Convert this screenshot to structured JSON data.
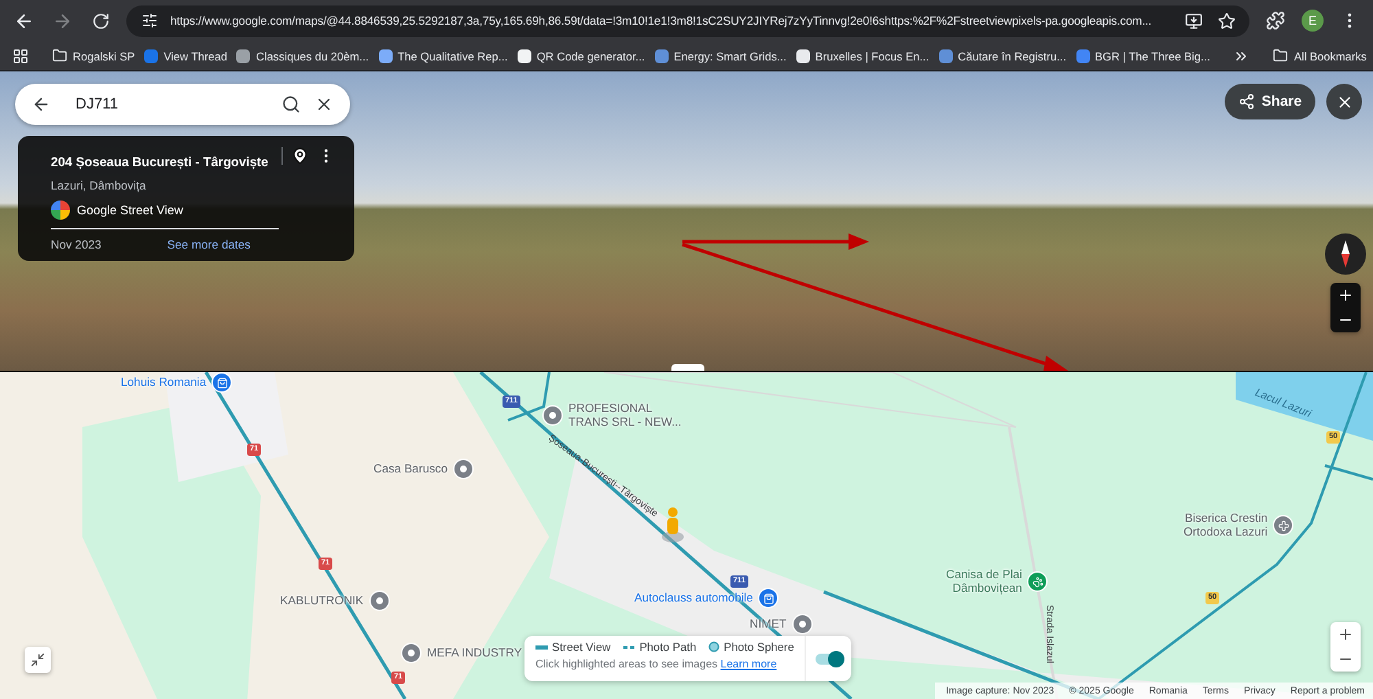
{
  "browser": {
    "url": "https://www.google.com/maps/@44.8846539,25.5292187,3a,75y,165.69h,86.59t/data=!3m10!1e1!3m8!1sC2SUY2JIYRej7zYyTinnvg!2e0!6shttps:%2F%2Fstreetviewpixels-pa.googleapis.com...",
    "profile": "E",
    "bookmarks": [
      {
        "label": "Rogalski SP",
        "kind": "folder"
      },
      {
        "label": "View Thread",
        "kind": "site",
        "color": "#1a73e8"
      },
      {
        "label": "Classiques du 20èm...",
        "kind": "site",
        "color": "#9aa0a6"
      },
      {
        "label": "The Qualitative Rep...",
        "kind": "site",
        "color": "#7cacf8"
      },
      {
        "label": "QR Code generator...",
        "kind": "site",
        "color": "#f1f3f4"
      },
      {
        "label": "Energy: Smart Grids...",
        "kind": "site",
        "color": "#5f8fd6"
      },
      {
        "label": "Bruxelles | Focus En...",
        "kind": "site",
        "color": "#e8eaed"
      },
      {
        "label": "Căutare în Registru...",
        "kind": "site",
        "color": "#5f8fd6"
      },
      {
        "label": "BGR | The Three Big...",
        "kind": "site",
        "color": "#4285f4"
      }
    ],
    "all_bookmarks": "All Bookmarks"
  },
  "street_view": {
    "search": {
      "value": "DJ711"
    },
    "place": {
      "title": "204 Șoseaua București - Târgoviște",
      "subtitle": "Lazuri, Dâmbovița",
      "source": "Google Street View",
      "date": "Nov 2023",
      "link": "See more dates"
    },
    "share": "Share"
  },
  "map": {
    "places": [
      {
        "lines": [
          "Lohuis Romania"
        ],
        "kind": "shop"
      },
      {
        "lines": [
          "PROFESIONAL",
          "TRANS SRL - NEW..."
        ],
        "kind": "business"
      },
      {
        "lines": [
          "Casa Barusco"
        ],
        "kind": "business"
      },
      {
        "lines": [
          "KABLUTRONIK"
        ],
        "kind": "business"
      },
      {
        "lines": [
          "MEFA INDUSTRY"
        ],
        "kind": "business"
      },
      {
        "lines": [
          "Autoclauss automobile"
        ],
        "kind": "shop"
      },
      {
        "lines": [
          "NIMET"
        ],
        "kind": "business"
      },
      {
        "lines": [
          "Canisa de Plai",
          "Dâmbovițean"
        ],
        "kind": "pet"
      },
      {
        "lines": [
          "Biserica Crestin",
          "Ortodoxa Lazuri"
        ],
        "kind": "church"
      }
    ],
    "shields": [
      {
        "label": "711",
        "kind": "county"
      },
      {
        "label": "71",
        "kind": "national"
      },
      {
        "label": "71",
        "kind": "national"
      },
      {
        "label": "71",
        "kind": "national"
      },
      {
        "label": "711",
        "kind": "county"
      },
      {
        "label": "50",
        "kind": "local"
      },
      {
        "label": "50",
        "kind": "local"
      }
    ],
    "streets": [
      "Șoseaua-București--Târgoviște",
      "Strada Islazul"
    ],
    "water_label": "Lacul Lazuri",
    "legend": {
      "items": [
        {
          "label": "Street View",
          "kind": "line"
        },
        {
          "label": "Photo Path",
          "kind": "dashed"
        },
        {
          "label": "Photo Sphere",
          "kind": "dot"
        }
      ],
      "hint": "Click highlighted areas to see images",
      "link": "Learn more",
      "on": true
    },
    "footer": [
      "Image capture: Nov 2023",
      "© 2025 Google",
      "Romania",
      "Terms",
      "Privacy",
      "Report a problem"
    ]
  }
}
